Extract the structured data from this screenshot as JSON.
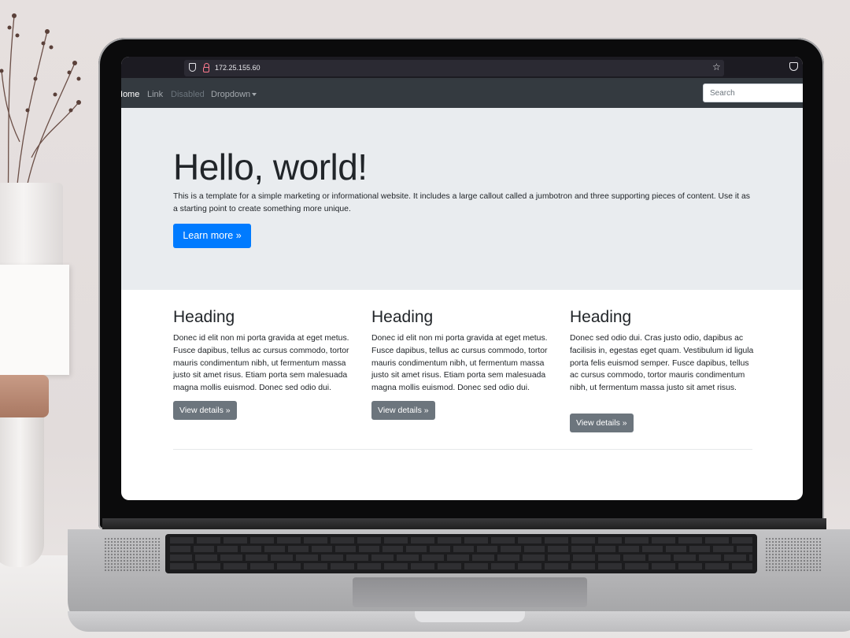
{
  "browser": {
    "url": "172.25.155.60"
  },
  "navbar": {
    "items": [
      {
        "label": "Home"
      },
      {
        "label": "Link"
      },
      {
        "label": "Disabled"
      },
      {
        "label": "Dropdown"
      }
    ],
    "search_placeholder": "Search"
  },
  "jumbotron": {
    "title": "Hello, world!",
    "text": "This is a template for a simple marketing or informational website. It includes a large callout called a jumbotron and three supporting pieces of content. Use it as a starting point to create something more unique.",
    "button_label": "Learn more »"
  },
  "columns": [
    {
      "heading": "Heading",
      "text": "Donec id elit non mi porta gravida at eget metus. Fusce dapibus, tellus ac cursus commodo, tortor mauris condimentum nibh, ut fermentum massa justo sit amet risus. Etiam porta sem malesuada magna mollis euismod. Donec sed odio dui.",
      "button_label": "View details »"
    },
    {
      "heading": "Heading",
      "text": "Donec id elit non mi porta gravida at eget metus. Fusce dapibus, tellus ac cursus commodo, tortor mauris condimentum nibh, ut fermentum massa justo sit amet risus. Etiam porta sem malesuada magna mollis euismod. Donec sed odio dui.",
      "button_label": "View details »"
    },
    {
      "heading": "Heading",
      "text": "Donec sed odio dui. Cras justo odio, dapibus ac facilisis in, egestas eget quam. Vestibulum id ligula porta felis euismod semper. Fusce dapibus, tellus ac cursus commodo, tortor mauris condimentum nibh, ut fermentum massa justo sit amet risus.",
      "button_label": "View details »"
    }
  ],
  "colors": {
    "primary": "#007bff",
    "secondary": "#6c757d",
    "navbar": "#343a40",
    "jumbotron": "#e9ecef"
  },
  "icons": [
    "shield-icon",
    "lock-icon",
    "star-icon",
    "pocket-icon",
    "caret-down-icon"
  ]
}
